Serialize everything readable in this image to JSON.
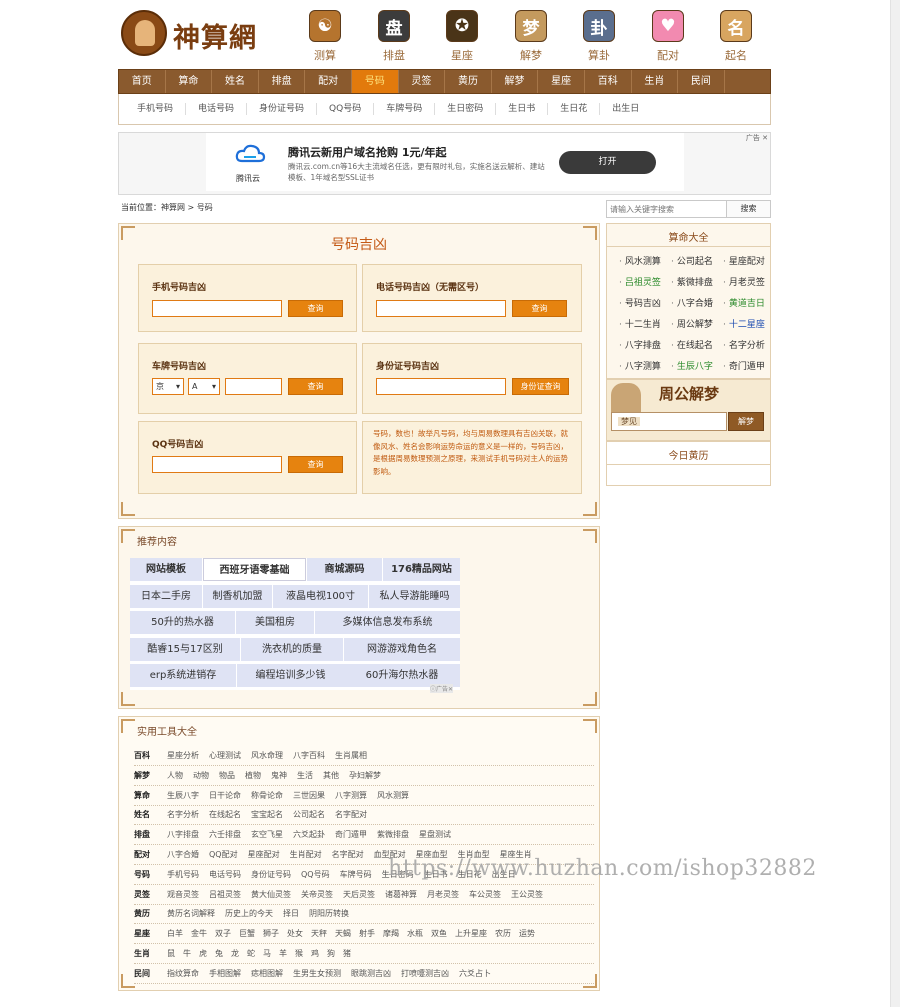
{
  "header": {
    "logo_text": "神算網"
  },
  "top_icons": [
    {
      "label": "测算",
      "glyph": "☯",
      "color": "#b5742e"
    },
    {
      "label": "排盘",
      "glyph": "盘",
      "color": "#3c3c3c"
    },
    {
      "label": "星座",
      "glyph": "✪",
      "color": "#4a3418"
    },
    {
      "label": "解梦",
      "glyph": "梦",
      "color": "#c49a5e"
    },
    {
      "label": "算卦",
      "glyph": "卦",
      "color": "#5a6e8e"
    },
    {
      "label": "配对",
      "glyph": "♥",
      "color": "#f28ab0"
    },
    {
      "label": "起名",
      "glyph": "名",
      "color": "#d8a560"
    }
  ],
  "main_nav": [
    "首页",
    "算命",
    "姓名",
    "排盘",
    "配对",
    "号码",
    "灵签",
    "黄历",
    "解梦",
    "星座",
    "百科",
    "生肖",
    "民间"
  ],
  "main_nav_active": "号码",
  "sub_nav": [
    "手机号码",
    "电话号码",
    "身份证号码",
    "QQ号码",
    "车牌号码",
    "生日密码",
    "生日书",
    "生日花",
    "出生日"
  ],
  "ad": {
    "title": "腾讯云新用户域名抢购 1元/年起",
    "desc": "腾讯云.com.cn等16大主流域名任选，更有限时礼包，实施名送云解析、建站模板、1年域名型SSL证书",
    "logo_text": "腾讯云",
    "button": "打开",
    "tag": "广告 ✕"
  },
  "breadcrumb": "当前位置：神算网 > 号码",
  "search": {
    "placeholder": "请输入关键字搜索",
    "button": "搜索"
  },
  "main_panel": {
    "title": "号码吉凶",
    "mobile_title": "手机号码吉凶",
    "phone_title": "电话号码吉凶（无需区号）",
    "plate_title": "车牌号码吉凶",
    "id_title": "身份证号码吉凶",
    "qq_title": "QQ号码吉凶",
    "query_label": "查询",
    "id_query_label": "身份证查询",
    "plate_province": "京",
    "plate_letter": "A",
    "note": "号码，数也！故举凡号码，均与周易数理具有吉凶关联，就像风水、姓名会影响运势命运的意义是一样的，号码吉凶，是根据周易数理预测之原理，来测试手机号码对主人的运势影响。"
  },
  "sidebar": {
    "title": "算命大全",
    "items": [
      {
        "t": "风水测算",
        "c": ""
      },
      {
        "t": "公司起名",
        "c": ""
      },
      {
        "t": "星座配对",
        "c": ""
      },
      {
        "t": "吕祖灵签",
        "c": "green"
      },
      {
        "t": "紫微排盘",
        "c": ""
      },
      {
        "t": "月老灵签",
        "c": ""
      },
      {
        "t": "号码吉凶",
        "c": ""
      },
      {
        "t": "八字合婚",
        "c": ""
      },
      {
        "t": "黄道吉日",
        "c": "green"
      },
      {
        "t": "十二生肖",
        "c": ""
      },
      {
        "t": "周公解梦",
        "c": ""
      },
      {
        "t": "十二星座",
        "c": "blue"
      },
      {
        "t": "八字排盘",
        "c": ""
      },
      {
        "t": "在线起名",
        "c": ""
      },
      {
        "t": "名字分析",
        "c": ""
      },
      {
        "t": "八字测算",
        "c": ""
      },
      {
        "t": "生辰八字",
        "c": "green"
      },
      {
        "t": "奇门遁甲",
        "c": ""
      }
    ],
    "dream_banner": "周公解梦",
    "dream_label": "梦见",
    "dream_button": "解梦",
    "almanac_title": "今日黄历"
  },
  "recommend": {
    "title": "推荐内容",
    "rows": [
      [
        "网站模板",
        "西班牙语零基础",
        "商城源码",
        "176精品网站"
      ],
      [
        "日本二手房",
        "制香机加盟",
        "液晶电视100寸",
        "私人导游能睡吗"
      ],
      [
        "50升的热水器",
        "美国租房",
        "多媒体信息发布系统"
      ],
      [
        "酷睿15与17区别",
        "洗衣机的质量",
        "网游游戏角色名"
      ],
      [
        "erp系统进销存",
        "编程培训多少钱",
        "60升海尔热水器"
      ]
    ],
    "ad_mark": "ⓘ广告✕"
  },
  "tools": {
    "title": "实用工具大全",
    "rows": [
      {
        "cat": "百科",
        "items": [
          "星座分析",
          "心理测试",
          "风水命理",
          "八字百科",
          "生肖属相"
        ]
      },
      {
        "cat": "解梦",
        "items": [
          "人物",
          "动物",
          "物品",
          "植物",
          "鬼神",
          "生活",
          "其他",
          "孕妇解梦"
        ]
      },
      {
        "cat": "算命",
        "items": [
          "生辰八字",
          "日干论命",
          "称骨论命",
          "三世因果",
          "八字测算",
          "风水测算"
        ]
      },
      {
        "cat": "姓名",
        "items": [
          "名字分析",
          "在线起名",
          "宝宝起名",
          "公司起名",
          "名字配对"
        ]
      },
      {
        "cat": "排盘",
        "items": [
          "八字排盘",
          "六壬排盘",
          "玄空飞星",
          "六爻起卦",
          "奇门遁甲",
          "紫微排盘",
          "星盘测试"
        ]
      },
      {
        "cat": "配对",
        "items": [
          "八字合婚",
          "QQ配对",
          "星座配对",
          "生肖配对",
          "名字配对",
          "血型配对",
          "星座血型",
          "生肖血型",
          "星座生肖"
        ]
      },
      {
        "cat": "号码",
        "items": [
          "手机号码",
          "电话号码",
          "身份证号码",
          "QQ号码",
          "车牌号码",
          "生日密码",
          "生日书",
          "生日花",
          "出生日"
        ]
      },
      {
        "cat": "灵签",
        "items": [
          "观音灵签",
          "吕祖灵签",
          "黄大仙灵签",
          "关帝灵签",
          "天后灵签",
          "诸葛神算",
          "月老灵签",
          "车公灵签",
          "王公灵签"
        ]
      },
      {
        "cat": "黄历",
        "items": [
          "黄历名词解释",
          "历史上的今天",
          "择日",
          "阴阳历转换"
        ]
      },
      {
        "cat": "星座",
        "items": [
          "白羊",
          "金牛",
          "双子",
          "巨蟹",
          "狮子",
          "处女",
          "天秤",
          "天蝎",
          "射手",
          "摩羯",
          "水瓶",
          "双鱼",
          "上升星座",
          "农历",
          "运势"
        ]
      },
      {
        "cat": "生肖",
        "items": [
          "鼠",
          "牛",
          "虎",
          "兔",
          "龙",
          "蛇",
          "马",
          "羊",
          "猴",
          "鸡",
          "狗",
          "猪"
        ]
      },
      {
        "cat": "民间",
        "items": [
          "指纹算命",
          "手相图解",
          "痣相图解",
          "生男生女预测",
          "眼跳测吉凶",
          "打喷嚏测吉凶",
          "六爻占卜"
        ]
      }
    ]
  },
  "watermark": "https://www.huzhan.com/ishop32882"
}
